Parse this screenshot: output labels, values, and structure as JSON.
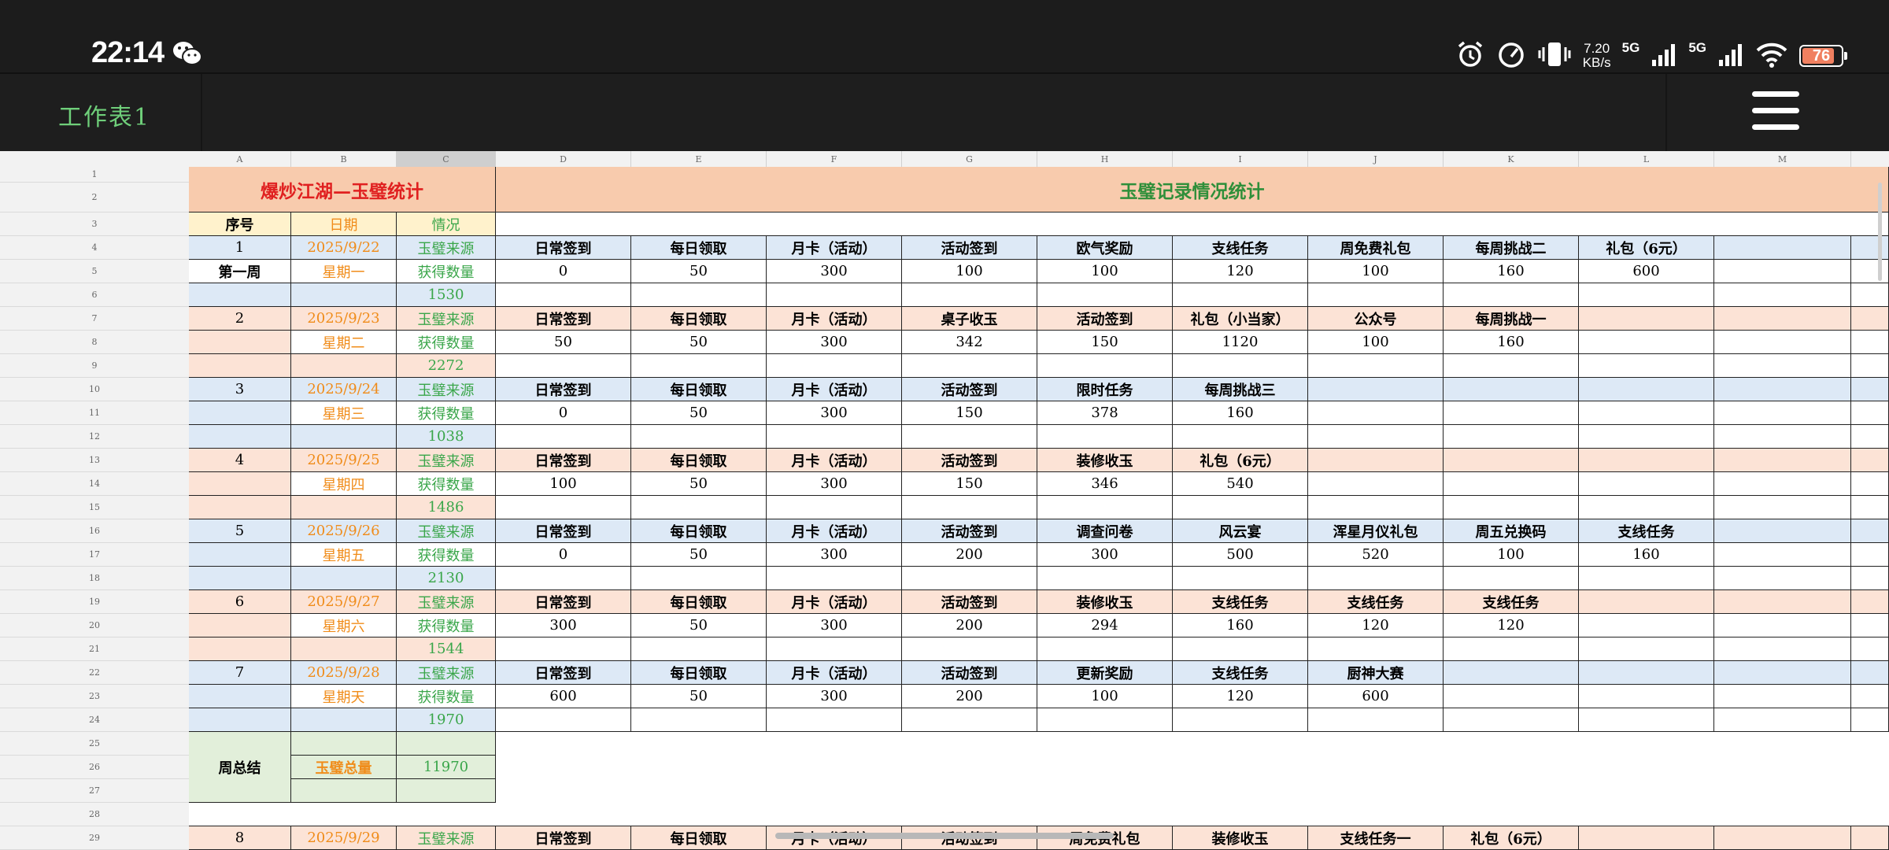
{
  "status_bar": {
    "time": "22:14",
    "net_speed_value": "7.20",
    "net_speed_unit": "KB/s",
    "sim1_type": "5G",
    "sim2_type": "5G",
    "battery_percent": 76,
    "icons": [
      "wechat-icon",
      "alarm-icon",
      "speedometer-icon",
      "vibrate-icon",
      "signal-icon",
      "wifi-icon",
      "battery-icon"
    ]
  },
  "app": {
    "sheet_title": "工作表1",
    "menu_icon": "hamburger-menu-icon",
    "title_color": "#6fcf7a"
  },
  "spreadsheet": {
    "column_letters": [
      "A",
      "B",
      "C",
      "D",
      "E",
      "F",
      "G",
      "H",
      "I",
      "J",
      "K",
      "L",
      "M"
    ],
    "selected_column": "C",
    "row_numbers": [
      "1",
      "2",
      "3",
      "4",
      "5",
      "6",
      "7",
      "8",
      "9",
      "10",
      "11",
      "12",
      "13",
      "14",
      "15",
      "16",
      "17",
      "18",
      "19",
      "20",
      "21",
      "22",
      "23",
      "24",
      "25",
      "26",
      "27",
      "28",
      "29"
    ],
    "title_left": "爆炒江湖—玉璧统计",
    "title_right": "玉璧记录情况统计",
    "header": {
      "index": "序号",
      "date": "日期",
      "status": "情况"
    },
    "days": [
      {
        "index": "1",
        "date": "2025/9/22",
        "weekday": "第一周",
        "weekday_style": "black",
        "source_label": "玉璧来源",
        "gain_label": "获得数量",
        "total": "1530",
        "band": "blue",
        "sources": [
          "日常签到",
          "每日领取",
          "月卡（活动）",
          "活动签到",
          "欧气奖励",
          "支线任务",
          "周免费礼包",
          "每周挑战二",
          "礼包（6元）"
        ],
        "amounts": [
          "0",
          "50",
          "300",
          "100",
          "100",
          "120",
          "100",
          "160",
          "600"
        ]
      },
      {
        "index": "2",
        "date": "2025/9/23",
        "weekday": "星期二",
        "weekday_style": "orange",
        "source_label": "玉璧来源",
        "gain_label": "获得数量",
        "total": "2272",
        "band": "pink",
        "sources": [
          "日常签到",
          "每日领取",
          "月卡（活动）",
          "桌子收玉",
          "活动签到",
          "礼包（小当家）",
          "公众号",
          "每周挑战一"
        ],
        "amounts": [
          "50",
          "50",
          "300",
          "342",
          "150",
          "1120",
          "100",
          "160"
        ]
      },
      {
        "index": "3",
        "date": "2025/9/24",
        "weekday": "星期三",
        "weekday_style": "orange",
        "source_label": "玉璧来源",
        "gain_label": "获得数量",
        "total": "1038",
        "band": "blue",
        "sources": [
          "日常签到",
          "每日领取",
          "月卡（活动）",
          "活动签到",
          "限时任务",
          "每周挑战三"
        ],
        "amounts": [
          "0",
          "50",
          "300",
          "150",
          "378",
          "160"
        ]
      },
      {
        "index": "4",
        "date": "2025/9/25",
        "weekday": "星期四",
        "weekday_style": "orange",
        "source_label": "玉璧来源",
        "gain_label": "获得数量",
        "total": "1486",
        "band": "pink",
        "sources": [
          "日常签到",
          "每日领取",
          "月卡（活动）",
          "活动签到",
          "装修收玉",
          "礼包（6元）"
        ],
        "amounts": [
          "100",
          "50",
          "300",
          "150",
          "346",
          "540"
        ]
      },
      {
        "index": "5",
        "date": "2025/9/26",
        "weekday": "星期五",
        "weekday_style": "orange",
        "source_label": "玉璧来源",
        "gain_label": "获得数量",
        "total": "2130",
        "band": "blue",
        "sources": [
          "日常签到",
          "每日领取",
          "月卡（活动）",
          "活动签到",
          "调查问卷",
          "风云宴",
          "浑星月仪礼包",
          "周五兑换码",
          "支线任务"
        ],
        "amounts": [
          "0",
          "50",
          "300",
          "200",
          "300",
          "500",
          "520",
          "100",
          "160"
        ]
      },
      {
        "index": "6",
        "date": "2025/9/27",
        "weekday": "星期六",
        "weekday_style": "orange",
        "source_label": "玉璧来源",
        "gain_label": "获得数量",
        "total": "1544",
        "band": "pink",
        "sources": [
          "日常签到",
          "每日领取",
          "月卡（活动）",
          "活动签到",
          "装修收玉",
          "支线任务",
          "支线任务",
          "支线任务"
        ],
        "amounts": [
          "300",
          "50",
          "300",
          "200",
          "294",
          "160",
          "120",
          "120"
        ]
      },
      {
        "index": "7",
        "date": "2025/9/28",
        "weekday": "星期天",
        "weekday_style": "orange",
        "source_label": "玉璧来源",
        "gain_label": "获得数量",
        "total": "1970",
        "band": "blue",
        "sources": [
          "日常签到",
          "每日领取",
          "月卡（活动）",
          "活动签到",
          "更新奖励",
          "支线任务",
          "厨神大赛"
        ],
        "amounts": [
          "600",
          "50",
          "300",
          "200",
          "100",
          "120",
          "600"
        ]
      }
    ],
    "weekly_summary": {
      "label": "周总结",
      "total_label": "玉璧总量",
      "total_value": "11970"
    },
    "next_row": {
      "index": "8",
      "date": "2025/9/29",
      "source_label": "玉璧来源",
      "sources": [
        "日常签到",
        "每日领取",
        "月卡（活动）",
        "活动签到",
        "周免费礼包",
        "装修收玉",
        "支线任务一",
        "礼包（6元）"
      ]
    },
    "colors": {
      "title_left": "#e02020",
      "title_right": "#2f8f3a",
      "orange": "#f08c1a",
      "green": "#3aa64a",
      "band_blue": "#dde9f6",
      "band_pink": "#fce3d6",
      "summary": "#e2efda",
      "header_yellow": "#fff2cc",
      "title_bg": "#f8cbad"
    }
  }
}
